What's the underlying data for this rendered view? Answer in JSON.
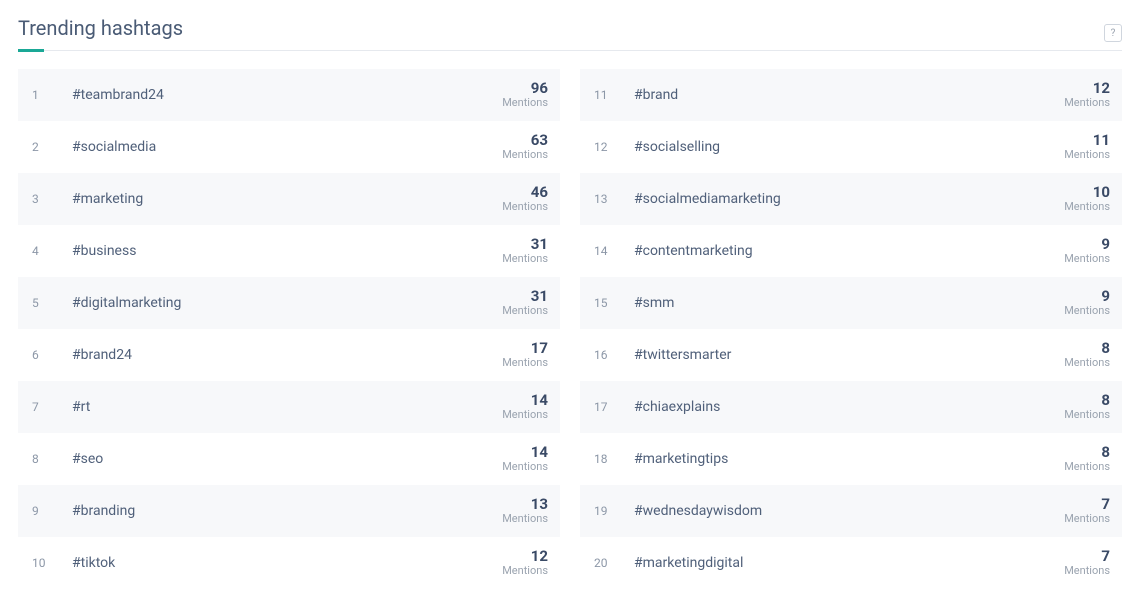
{
  "title": "Trending hashtags",
  "help": "?",
  "mentions_label": "Mentions",
  "left": [
    {
      "rank": "1",
      "tag": "#teambrand24",
      "count": "96"
    },
    {
      "rank": "2",
      "tag": "#socialmedia",
      "count": "63"
    },
    {
      "rank": "3",
      "tag": "#marketing",
      "count": "46"
    },
    {
      "rank": "4",
      "tag": "#business",
      "count": "31"
    },
    {
      "rank": "5",
      "tag": "#digitalmarketing",
      "count": "31"
    },
    {
      "rank": "6",
      "tag": "#brand24",
      "count": "17"
    },
    {
      "rank": "7",
      "tag": "#rt",
      "count": "14"
    },
    {
      "rank": "8",
      "tag": "#seo",
      "count": "14"
    },
    {
      "rank": "9",
      "tag": "#branding",
      "count": "13"
    },
    {
      "rank": "10",
      "tag": "#tiktok",
      "count": "12"
    }
  ],
  "right": [
    {
      "rank": "11",
      "tag": "#brand",
      "count": "12"
    },
    {
      "rank": "12",
      "tag": "#socialselling",
      "count": "11"
    },
    {
      "rank": "13",
      "tag": "#socialmediamarketing",
      "count": "10"
    },
    {
      "rank": "14",
      "tag": "#contentmarketing",
      "count": "9"
    },
    {
      "rank": "15",
      "tag": "#smm",
      "count": "9"
    },
    {
      "rank": "16",
      "tag": "#twittersmarter",
      "count": "8"
    },
    {
      "rank": "17",
      "tag": "#chiaexplains",
      "count": "8"
    },
    {
      "rank": "18",
      "tag": "#marketingtips",
      "count": "8"
    },
    {
      "rank": "19",
      "tag": "#wednesdaywisdom",
      "count": "7"
    },
    {
      "rank": "20",
      "tag": "#marketingdigital",
      "count": "7"
    }
  ]
}
